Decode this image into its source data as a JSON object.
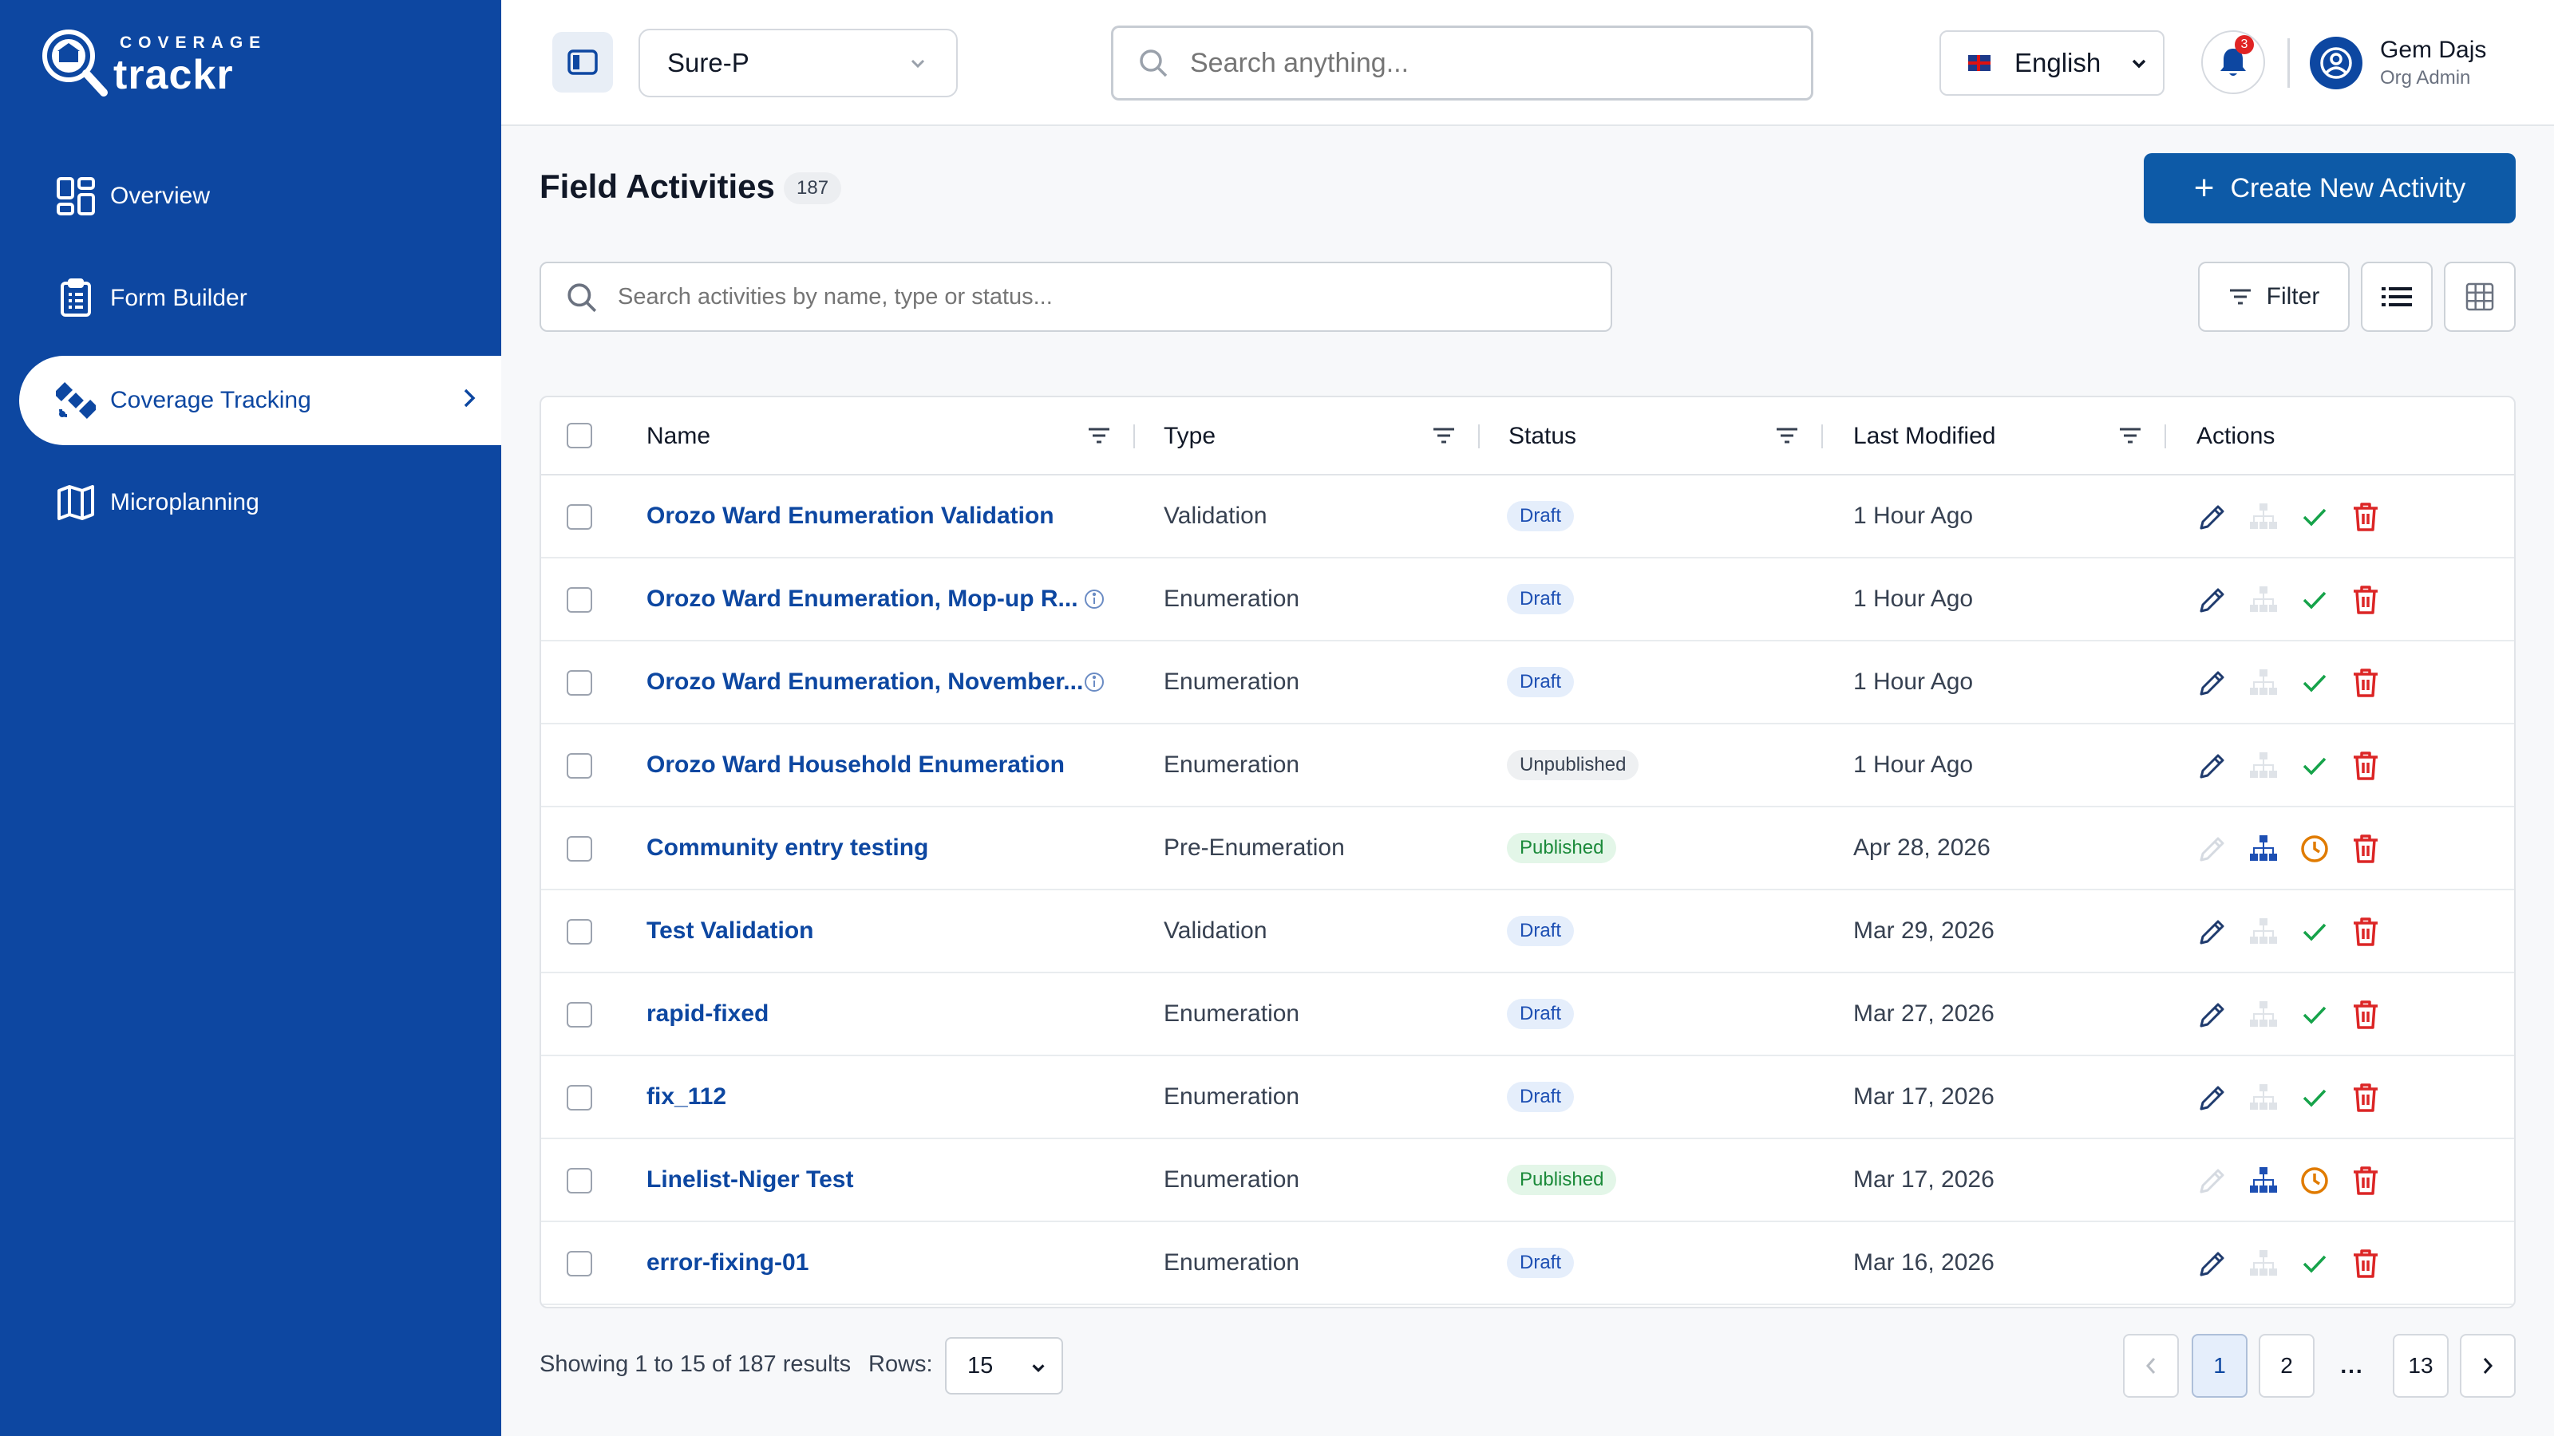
{
  "brand": {
    "top": "COVERAGE",
    "main": "trackr"
  },
  "sidebar": {
    "items": [
      {
        "label": "Overview",
        "icon": "dashboard-icon"
      },
      {
        "label": "Form Builder",
        "icon": "clipboard-icon"
      },
      {
        "label": "Coverage Tracking",
        "icon": "satellite-icon",
        "active": true
      },
      {
        "label": "Microplanning",
        "icon": "map-icon"
      }
    ]
  },
  "topbar": {
    "org": "Sure-P",
    "search_placeholder": "Search anything...",
    "language": "English",
    "notifications": "3",
    "user": {
      "name": "Gem Dajs",
      "role": "Org Admin"
    }
  },
  "page": {
    "title": "Field Activities",
    "count": "187",
    "create_label": "Create New Activity",
    "search_placeholder": "Search activities by name, type or status...",
    "filter_label": "Filter"
  },
  "table": {
    "columns": [
      "Name",
      "Type",
      "Status",
      "Last Modified",
      "Actions"
    ],
    "rows": [
      {
        "name": "Orozo Ward Enumeration Validation",
        "type": "Validation",
        "status": "Draft",
        "modified": "1 Hour Ago",
        "info": false
      },
      {
        "name": "Orozo Ward Enumeration, Mop-up R...",
        "type": "Enumeration",
        "status": "Draft",
        "modified": "1 Hour Ago",
        "info": true
      },
      {
        "name": "Orozo Ward Enumeration, November...",
        "type": "Enumeration",
        "status": "Draft",
        "modified": "1 Hour Ago",
        "info": true
      },
      {
        "name": "Orozo Ward Household Enumeration",
        "type": "Enumeration",
        "status": "Unpublished",
        "modified": "1 Hour Ago",
        "info": false
      },
      {
        "name": "Community entry testing",
        "type": "Pre-Enumeration",
        "status": "Published",
        "modified": "Apr 28, 2026",
        "info": false
      },
      {
        "name": "Test Validation",
        "type": "Validation",
        "status": "Draft",
        "modified": "Mar 29, 2026",
        "info": false
      },
      {
        "name": "rapid-fixed",
        "type": "Enumeration",
        "status": "Draft",
        "modified": "Mar 27, 2026",
        "info": false
      },
      {
        "name": "fix_112",
        "type": "Enumeration",
        "status": "Draft",
        "modified": "Mar 17, 2026",
        "info": false
      },
      {
        "name": "Linelist-Niger Test",
        "type": "Enumeration",
        "status": "Published",
        "modified": "Mar 17, 2026",
        "info": false
      },
      {
        "name": "error-fixing-01",
        "type": "Enumeration",
        "status": "Draft",
        "modified": "Mar 16, 2026",
        "info": false
      }
    ]
  },
  "footer": {
    "showing": "Showing 1 to 15 of 187 results",
    "rows_label": "Rows:",
    "rows_value": "15",
    "pages": [
      "1",
      "2",
      "...",
      "13"
    ]
  },
  "colors": {
    "brand": "#0d47a1",
    "primary_button": "#0d5aa7",
    "draft": "#1d4fb3",
    "published": "#1b8a3a",
    "delete": "#dc2626",
    "pending": "#e07b00",
    "approve": "#16a34a"
  }
}
